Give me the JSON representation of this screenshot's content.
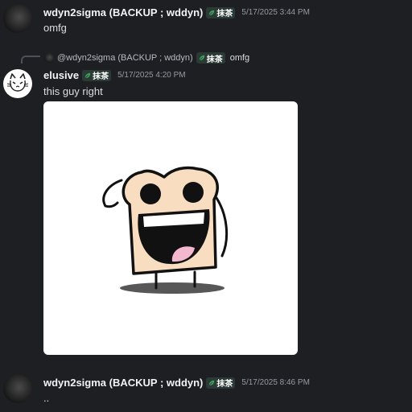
{
  "messages": [
    {
      "username": "wdyn2sigma (BACKUP ; wddyn)",
      "tag": "抹茶",
      "timestamp": "5/17/2025 3:44 PM",
      "text": "omfg"
    },
    {
      "reply": {
        "username": "@wdyn2sigma (BACKUP ; wddyn)",
        "tag": "抹茶",
        "text": "omfg"
      },
      "username": "elusive",
      "tag": "抹茶",
      "timestamp": "5/17/2025 4:20 PM",
      "text": "this guy right"
    },
    {
      "username": "wdyn2sigma (BACKUP ; wddyn)",
      "tag": "抹茶",
      "timestamp": "5/17/2025 8:46 PM",
      "text": ".."
    }
  ],
  "colors": {
    "background": "#1e1f22",
    "username": "#f2f3f5",
    "timestamp": "#949ba4",
    "tag_leaf": "#3ba55c"
  },
  "icons": {
    "tag": "leaf-icon",
    "image": "smiling-toast-cartoon"
  }
}
